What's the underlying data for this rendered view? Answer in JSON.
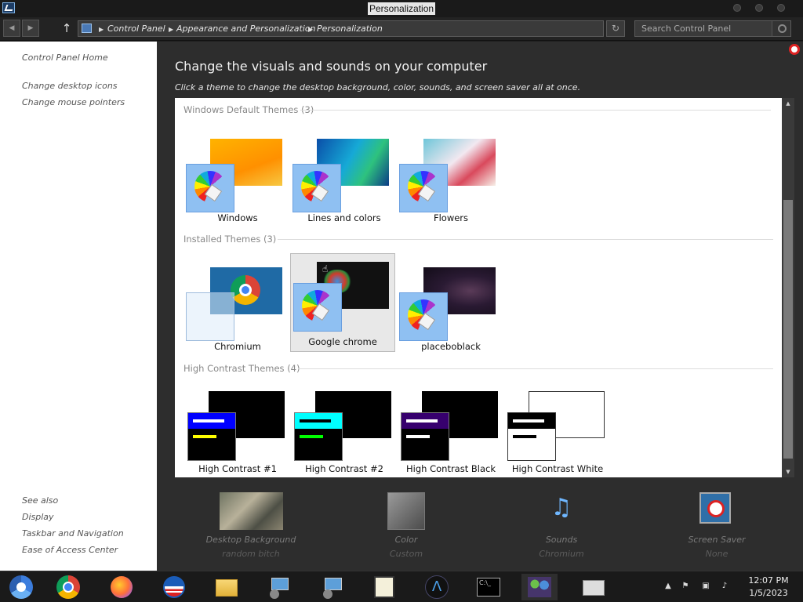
{
  "window": {
    "title": "Personalization"
  },
  "address": {
    "crumbs": [
      "Control Panel",
      "Appearance and Personalization",
      "Personalization"
    ],
    "search_placeholder": "Search Control Panel"
  },
  "left": {
    "home": "Control Panel Home",
    "links": [
      "Change desktop icons",
      "Change mouse pointers"
    ],
    "see_also_title": "See also",
    "see_also": [
      "Display",
      "Taskbar and Navigation",
      "Ease of Access Center"
    ]
  },
  "main": {
    "heading": "Change the visuals and sounds on your computer",
    "subheading": "Click a theme to change the desktop background, color, sounds, and screen saver all at once."
  },
  "groups": [
    {
      "title": "Windows Default Themes (3)",
      "themes": [
        "Windows",
        "Lines and colors",
        "Flowers"
      ]
    },
    {
      "title": "Installed Themes (3)",
      "themes": [
        "Chromium",
        "Google chrome",
        "placeboblack"
      ],
      "selected": "Google chrome"
    },
    {
      "title": "High Contrast Themes (4)",
      "themes": [
        "High Contrast #1",
        "High Contrast #2",
        "High Contrast Black",
        "High Contrast White"
      ]
    }
  ],
  "bottom": [
    {
      "title": "Desktop Background",
      "value": "random bitch"
    },
    {
      "title": "Color",
      "value": "Custom"
    },
    {
      "title": "Sounds",
      "value": "Chromium"
    },
    {
      "title": "Screen Saver",
      "value": "None"
    }
  ],
  "taskbar": {
    "time": "12:07 PM",
    "date": "1/5/2023",
    "icons": [
      "chromium-icon",
      "chrome-icon",
      "firefox-icon",
      "obama-logo-icon",
      "file-explorer-icon",
      "network-tool-icon",
      "network-tool-2-icon",
      "pixel-dog-icon",
      "arch-icon",
      "cmd-icon",
      "users-icon",
      "register-icon"
    ],
    "active_icon": "users-icon"
  },
  "colors": {
    "main_bg": "#2d2d2d",
    "accent": "#6a9fe0"
  }
}
